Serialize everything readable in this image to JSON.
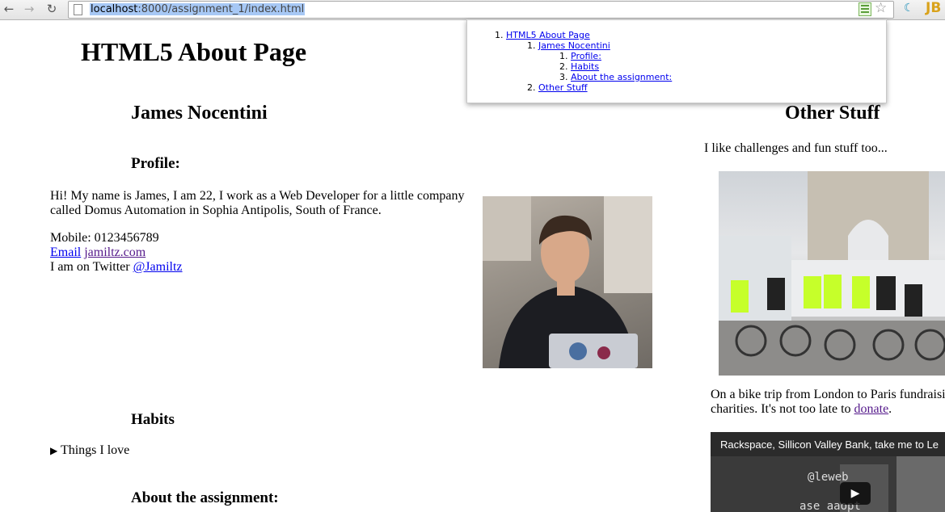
{
  "browser": {
    "url_host": "localhost",
    "url_rest": ":8000/assignment_1/index.html",
    "back": "←",
    "forward": "→",
    "reload": "↻",
    "star": "☆",
    "ext2": "☾",
    "ext3": "JB"
  },
  "outline": {
    "item1": "HTML5 About Page",
    "item1_1": "James Nocentini",
    "item1_1_1": "Profile:",
    "item1_1_2": "Habits",
    "item1_1_3": "About the assignment:",
    "item1_2": "Other Stuff"
  },
  "page": {
    "title": "HTML5 About Page",
    "section_name": "James Nocentini",
    "profile_heading": "Profile:",
    "intro": "Hi! My name is James, I am 22, I work as a Web Developer for a little company called Domus Automation in Sophia Antipolis, South of France.",
    "mobile": "Mobile: 0123456789",
    "email_link": "Email",
    "site_link": "jamiltz.com",
    "twitter_prefix": "I am on Twitter ",
    "twitter_link": "@Jamiltz",
    "habits_heading": "Habits",
    "details_marker": "▶",
    "details_summary": "Things I love",
    "about_heading": "About the assignment:",
    "other_heading": "Other Stuff",
    "other_intro": "I like challenges and fun stuff too...",
    "bike_text": "On a bike trip from London to Paris fundraising for",
    "bike_text2": "charities. It's not too late to ",
    "donate_link": "donate",
    "period": ".",
    "video_title": "Rackspace, Sillicon Valley Bank, take me to Le",
    "play": "▶"
  }
}
